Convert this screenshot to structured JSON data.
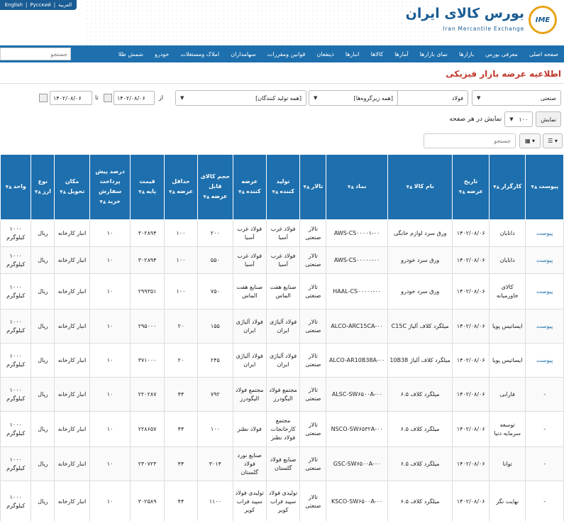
{
  "header": {
    "langs": [
      "English",
      "Русский",
      "العربية"
    ],
    "logo_title": "بورس کالای ایران",
    "logo_sub": "Iran Mercantile Exchange",
    "logo_mark": "IME"
  },
  "nav": {
    "items": [
      "صفحه اصلی",
      "معرفی بورس",
      "بازارها",
      "نمای بازارها",
      "آمارها",
      "کالاها",
      "انبارها",
      "ذینفعان",
      "قوانین ومقررات",
      "سهامداران",
      "املاک ومستغلات",
      "خودرو",
      "شمش طلا"
    ],
    "search_placeholder": "جستجو"
  },
  "page_title": "اطلاعیه عرضه بازار فیزیکی",
  "filters": {
    "market": "صنعتی",
    "commodity": "فولاد",
    "subgroup": "[همه زیرگروه‌ها]",
    "producer": "[همه تولید کنندگان]",
    "from_label": "از",
    "to_label": "تا",
    "date_from": "۱۴۰۲/۰۸/۰۶",
    "date_to": "۱۴۰۲/۰۸/۰۶"
  },
  "paging": {
    "per_page_label": "نمایش در هر صفحه",
    "per_page_value": "۱۰۰",
    "show_button": "نمایش"
  },
  "table_search_placeholder": "جستجو",
  "table": {
    "columns": [
      "پیوست",
      "کارگزار",
      "تاریخ عرضه",
      "نام کالا",
      "نماد",
      "تالار",
      "تولید کننده",
      "عرضه کننده",
      "حجم کالای قابل عرضه",
      "حداقل عرضه",
      "قیمت پایه",
      "درصد پیش پرداخت سفارش خرید",
      "مکان تحویل",
      "نوع ارز",
      "واحد"
    ],
    "rows": [
      [
        "پیوست",
        "دانایان",
        "۱۴۰۲/۰۸/۰۶",
        "ورق سرد لوازم خانگی",
        "AWS-CS۰۰۰۰۱-۰۰",
        "تالار صنعتی",
        "فولاد غرب آسیا",
        "فولاد غرب آسیا",
        "۲۰۰",
        "۱۰۰",
        "۳۰۲۸۹۴",
        "۱۰",
        "انبار کارخانه",
        "ریال",
        "۱۰۰۰ کیلوگرم"
      ],
      [
        "پیوست",
        "دانایان",
        "۱۴۰۲/۰۸/۰۶",
        "ورق سرد خودرو",
        "AWS-CS۰۰۰۰۰-۰۰",
        "تالار صنعتی",
        "فولاد غرب آسیا",
        "فولاد غرب آسیا",
        "۵۵۰",
        "۱۰۰",
        "۳۰۲۸۹۴",
        "۱۰",
        "انبار کارخانه",
        "ریال",
        "۱۰۰۰ کیلوگرم"
      ],
      [
        "پیوست",
        "کالای خاورمیانه",
        "۱۴۰۲/۰۸/۰۶",
        "ورق سرد خودرو",
        "HAAL-CS۰۰۰۰۰-۰۰",
        "تالار صنعتی",
        "صنایع هفت الماس",
        "صنایع هفت الماس",
        "۷۵۰",
        "۱۰۰",
        "۲۹۹۳۵۱",
        "۱۰",
        "انبار کارخانه",
        "ریال",
        "۱۰۰۰ کیلوگرم"
      ],
      [
        "پیوست",
        "ایساتیس پویا",
        "۱۴۰۲/۰۸/۰۶",
        "میلگرد کلاف آلیاژ C15C",
        "ALCO-ARC15CA-۰۰",
        "تالار صنعتی",
        "فولاد آلیاژی ایران",
        "فولاد آلیاژی ایران",
        "۱۵۵",
        "۲۰",
        "۲۹۵۰۰۰",
        "۱۰",
        "انبار کارخانه",
        "ریال",
        "۱۰۰۰ کیلوگرم"
      ],
      [
        "پیوست",
        "ایساتیس پویا",
        "۱۴۰۲/۰۸/۰۶",
        "میلگرد کلاف آلیاژ 10B38",
        "ALCO-AR10B38A-۰۰",
        "تالار صنعتی",
        "فولاد آلیاژی ایران",
        "فولاد آلیاژی ایران",
        "۲۴۵",
        "۲۰",
        "۳۷۱۰۰۰",
        "۱۰",
        "انبار کارخانه",
        "ریال",
        "۱۰۰۰ کیلوگرم"
      ],
      [
        "-",
        "فارابی",
        "۱۴۰۲/۰۸/۰۶",
        "میلگرد کلاف ۶.۵",
        "ALSC-SW۶۵۰۰A-۰۰",
        "تالار صنعتی",
        "مجتمع فولاد الیگودرز",
        "مجتمع فولاد الیگودرز",
        "۷۹۲",
        "۴۴",
        "۲۲۰۲۸۷",
        "۱۰",
        "انبار کارخانه",
        "ریال",
        "۱۰۰۰ کیلوگرم"
      ],
      [
        "-",
        "توسعه سرمایه دنیا",
        "۱۴۰۲/۰۸/۰۶",
        "میلگرد کلاف ۶.۵",
        "NSCO-SW۶۵۳۲A-۰۰",
        "تالار صنعتی",
        "مجتمع کارخانجات فولاد نطنز",
        "فولاد نطنز",
        "۱۰۰",
        "۴۴",
        "۲۲۸۶۵۷",
        "۱۰",
        "انبار کارخانه",
        "ریال",
        "۱۰۰۰ کیلوگرم"
      ],
      [
        "-",
        "توانا",
        "۱۴۰۲/۰۸/۰۶",
        "میلگرد کلاف ۶.۵",
        "GSC-SW۶۵۰۰A-۰۰",
        "تالار صنعتی",
        "صنایع فولاد گلستان",
        "صنایع نورد فولاد گلستان",
        "۳۰۱۴",
        "۴۴",
        "۲۳۰۷۲۳",
        "۱۰",
        "انبار کارخانه",
        "ریال",
        "۱۰۰۰ کیلوگرم"
      ],
      [
        "-",
        "نهایت نگر",
        "۱۴۰۲/۰۸/۰۶",
        "میلگرد کلاف ۶.۵",
        "KSCO-SW۶۵۰۰A-۰۰",
        "تالار صنعتی",
        "تولیدی فولاد سپید فراب کویر",
        "تولیدی فولاد سپید فراب کویر",
        "۱۱۰۰",
        "۴۴",
        "۳۰۲۵۸۹",
        "۱۰",
        "انبار کارخانه",
        "ریال",
        "۱۰۰۰ کیلوگرم"
      ]
    ]
  }
}
